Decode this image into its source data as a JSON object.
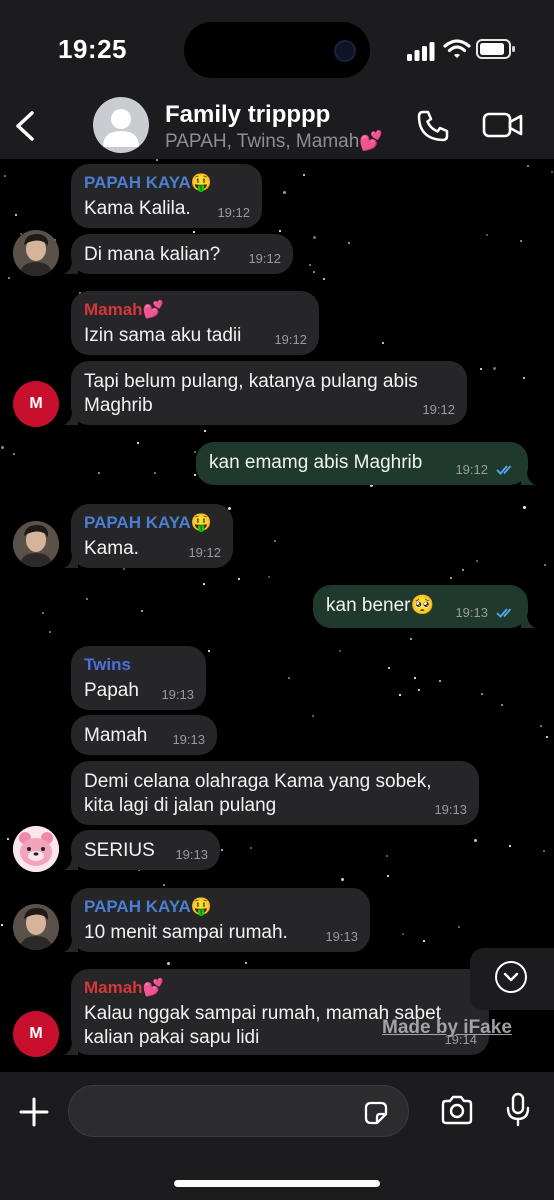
{
  "status_bar": {
    "time": "19:25"
  },
  "header": {
    "title": "Family tripppp",
    "members": "PAPAH, Twins, Mamah💕",
    "icons": {
      "back": "back-chevron-icon",
      "call": "phone-icon",
      "video": "video-camera-icon",
      "avatar": "group-avatar-icon"
    }
  },
  "colors": {
    "sender_papah": "#4a7fd1",
    "sender_mamah": "#d6373a",
    "sender_twins": "#4d6ee0",
    "outgoing_bubble": "#1f3a2d",
    "incoming_bubble": "#262628",
    "read_ticks": "#53a7f5"
  },
  "messages": [
    {
      "sender": "PAPAH KAYA🤑",
      "text": "Kama Kalila.",
      "time": "19:12"
    },
    {
      "sender": "",
      "text": "Di mana kalian?",
      "time": "19:12"
    },
    {
      "sender": "Mamah💕",
      "text": "Izin sama aku tadii",
      "time": "19:12"
    },
    {
      "sender": "",
      "text": "Tapi belum pulang, katanya pulang abis Maghrib",
      "time": "19:12"
    },
    {
      "sender": "",
      "text": "kan emamg abis Maghrib",
      "time": "19:12",
      "status": "read"
    },
    {
      "sender": "PAPAH KAYA🤑",
      "text": "Kama.",
      "time": "19:12"
    },
    {
      "sender": "",
      "text": "kan bener🥺",
      "time": "19:13",
      "status": "read"
    },
    {
      "sender": "Twins",
      "text": "Papah",
      "time": "19:13"
    },
    {
      "sender": "",
      "text": "Mamah",
      "time": "19:13"
    },
    {
      "sender": "",
      "text": "Demi celana olahraga Kama yang sobek, kita lagi di jalan pulang",
      "time": "19:13"
    },
    {
      "sender": "",
      "text": "SERIUS",
      "time": "19:13"
    },
    {
      "sender": "PAPAH KAYA🤑",
      "text": "10 menit sampai rumah.",
      "time": "19:13"
    },
    {
      "sender": "Mamah💕",
      "text": "Kalau nggak sampai rumah, mamah sabet kalian pakai sapu lidi",
      "time": "19:14"
    }
  ],
  "avatars": {
    "mamah_initial": "M"
  },
  "watermark": "Made by iFake",
  "composer": {
    "placeholder": "",
    "icons": [
      "plus-icon",
      "sticker-icon",
      "camera-icon",
      "microphone-icon"
    ]
  }
}
